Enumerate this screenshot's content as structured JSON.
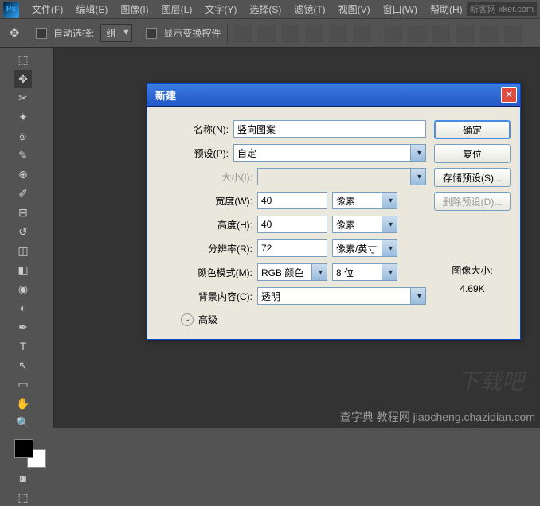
{
  "app": {
    "logo": "Ps"
  },
  "menu": {
    "file": "文件(F)",
    "edit": "编辑(E)",
    "image": "图像(I)",
    "layer": "图层(L)",
    "type": "文字(Y)",
    "select": "选择(S)",
    "filter": "滤镜(T)",
    "view": "视图(V)",
    "window": "窗口(W)",
    "help": "帮助(H)"
  },
  "optbar": {
    "autoselect": "自动选择:",
    "group": "组",
    "transform": "显示变换控件"
  },
  "dialog": {
    "title": "新建",
    "labels": {
      "name": "名称(N):",
      "preset": "预设(P):",
      "size": "大小(I):",
      "width": "宽度(W):",
      "height": "高度(H):",
      "resolution": "分辨率(R):",
      "colormode": "颜色模式(M):",
      "background": "背景内容(C):",
      "advanced": "高级"
    },
    "values": {
      "name": "竖向图案",
      "preset": "自定",
      "width": "40",
      "height": "40",
      "resolution": "72",
      "colormode": "RGB 颜色",
      "bitdepth": "8 位",
      "background": "透明",
      "unit_px": "像素",
      "unit_ppi": "像素/英寸"
    },
    "buttons": {
      "ok": "确定",
      "reset": "复位",
      "save": "存储预设(S)...",
      "delete": "删除预设(D)..."
    },
    "sizeinfo": {
      "label": "图像大小:",
      "value": "4.69K"
    }
  },
  "watermarks": {
    "top": "新客网 xker.com",
    "dl": "下载吧",
    "bot": "查字典 教程网  jiaocheng.chazidian.com"
  }
}
